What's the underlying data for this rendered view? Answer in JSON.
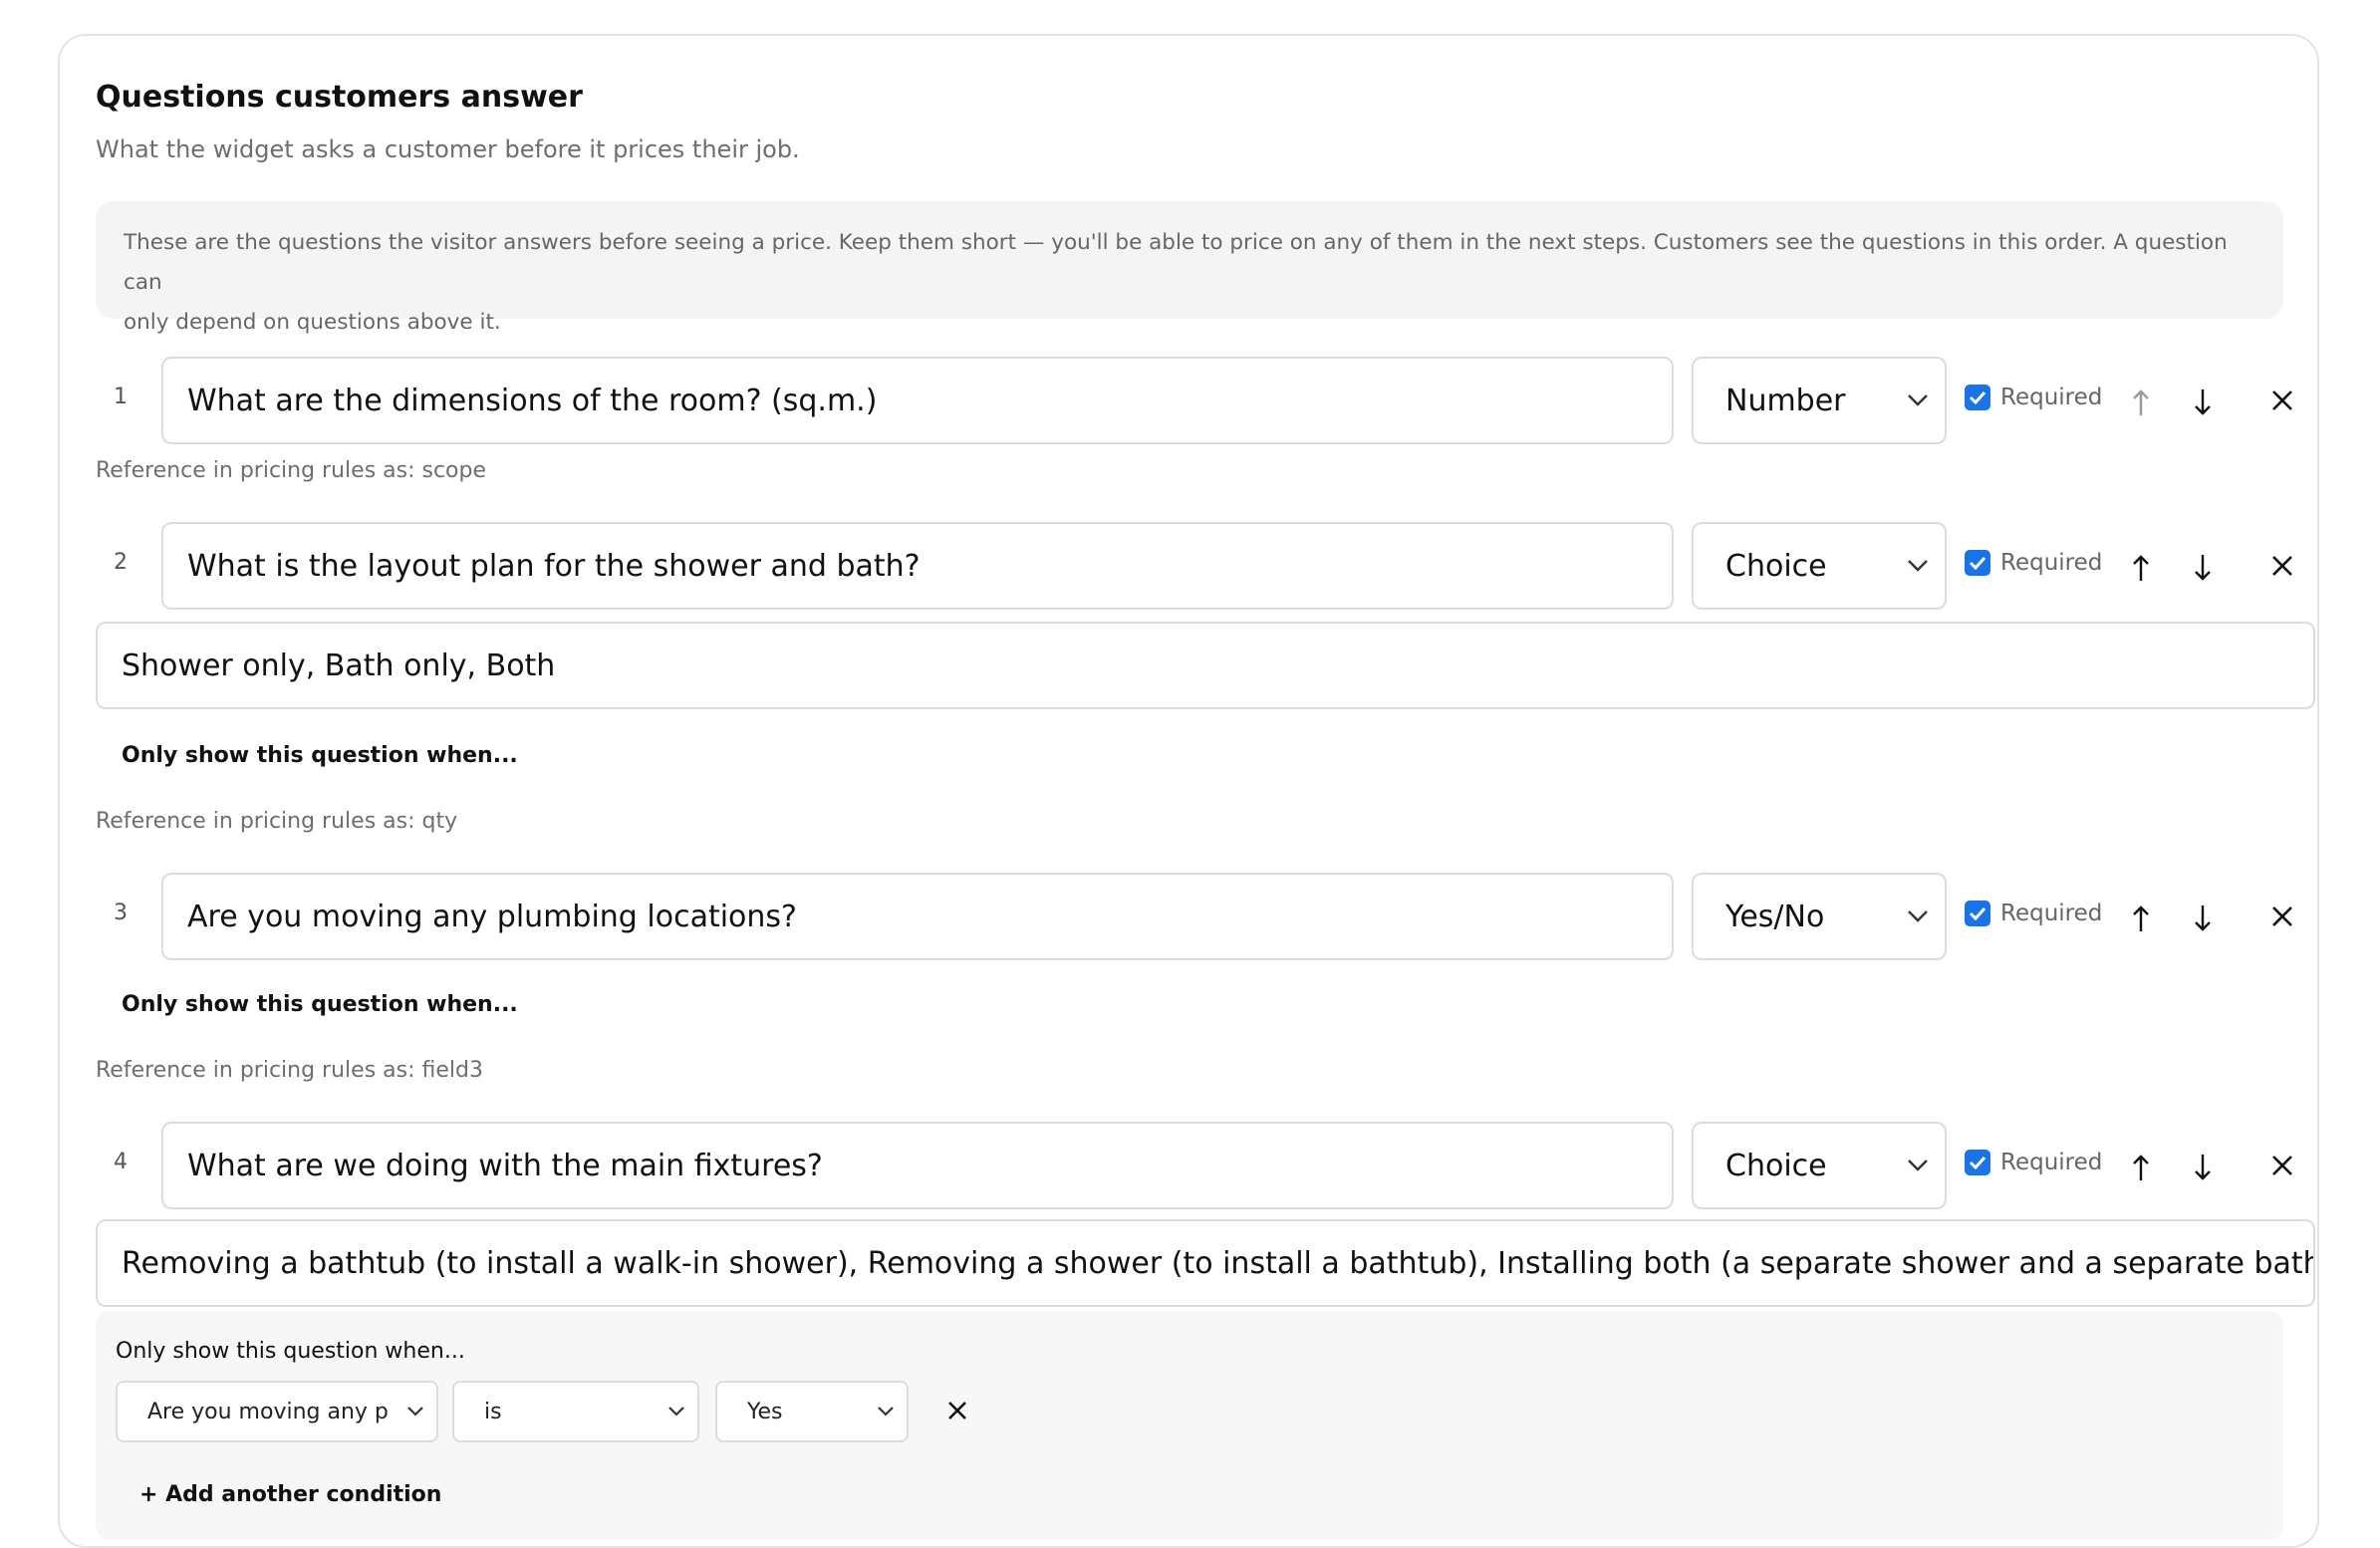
{
  "section": {
    "title": "Questions customers answer",
    "subtitle": "What the widget asks a customer before it prices their job.",
    "info_line1": "These are the questions the visitor answers before seeing a price. Keep them short — you'll be able to price on any of them in the next steps. Customers see the questions in this order. A question can",
    "info_line2": "only depend on questions above it."
  },
  "labels": {
    "required": "Required",
    "conditional": "Only show this question when...",
    "add_condition": "+ Add another condition"
  },
  "questions": [
    {
      "num": "1",
      "text": "What are the dimensions of the room? (sq.m.)",
      "type": "Number",
      "required": true,
      "reference": "Reference in pricing rules as: scope"
    },
    {
      "num": "2",
      "text": "What is the layout plan for the shower and bath?",
      "type": "Choice",
      "required": true,
      "options": "Shower only, Bath only, Both",
      "reference": "Reference in pricing rules as: qty"
    },
    {
      "num": "3",
      "text": "Are you moving any plumbing locations?",
      "type": "Yes/No",
      "required": true,
      "reference": "Reference in pricing rules as: field3"
    },
    {
      "num": "4",
      "text": "What are we doing with the main fixtures?",
      "type": "Choice",
      "required": true,
      "options": "Removing a bathtub (to install a walk-in shower), Removing a shower (to install a bathtub), Installing both (a separate shower and a separate bathtub), K",
      "condition": {
        "question": "Are you moving any p",
        "operator": "is",
        "value": "Yes"
      }
    }
  ],
  "icons": {
    "up": "arrow-up-icon",
    "down": "arrow-down-icon",
    "remove": "close-icon",
    "dropdown": "chevron-down-icon",
    "check": "checkmark-icon"
  },
  "colors": {
    "accent": "#1a73e8",
    "border": "#dcdcdc",
    "muted_text": "#6e6e6e",
    "info_bg": "#f4f4f4"
  }
}
